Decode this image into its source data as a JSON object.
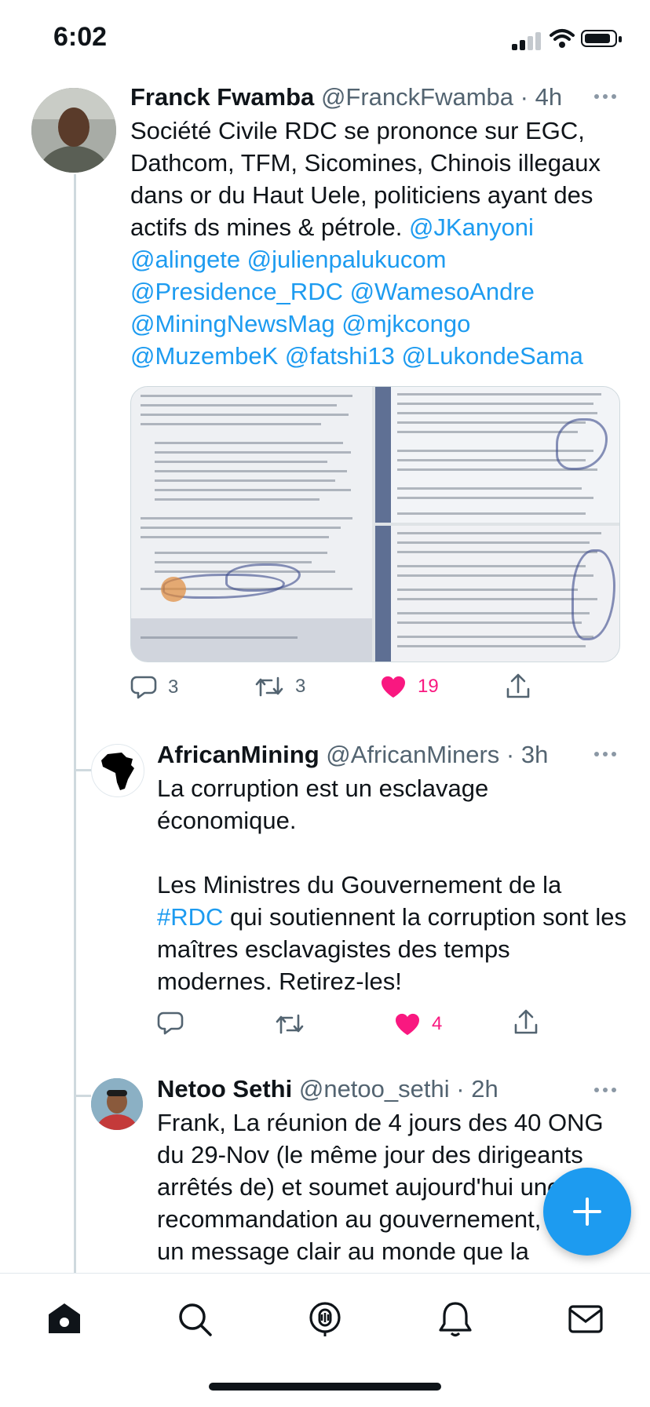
{
  "status_bar": {
    "time": "6:02",
    "battery_level": 0.8
  },
  "tweets": [
    {
      "display_name": "Franck Fwamba",
      "handle": "@FranckFwamba",
      "time": "· 4h",
      "text": "Société Civile RDC se prononce sur EGC, Dathcom, TFM, Sicomines, Chinois illegaux dans or du Haut Uele, politiciens ayant des actifs ds mines & pétrole. ",
      "mentions": "@JKanyoni @alingete @julienpalukucom @Presidence_RDC @WamesoAndre @MiningNewsMag @mjkcongo @MuzembeK @fatshi13 @LukondeSama",
      "replies": "3",
      "retweets": "3",
      "likes": "19"
    },
    {
      "display_name": "AfricanMining",
      "handle": "@AfricanMiners",
      "time": "· 3h",
      "text_part1": "La corruption est un esclavage économique.\n\nLes Ministres du Gouvernement de la ",
      "hashtag": "#RDC",
      "text_part2": " qui soutiennent la corruption sont les maîtres esclavagistes des temps modernes. Retirez-les!",
      "likes": "4"
    },
    {
      "display_name": "Netoo Sethi",
      "handle": "@netoo_sethi",
      "time": "· 2h",
      "text": "Frank, La réunion de 4 jours des 40 ONG du 29-Nov (le même jour des dirigeants arrêtés de) et soumet aujourd'hui une recommandation au gouvernement, envoie un message clair au monde que la"
    }
  ],
  "tab_bar": {
    "items": [
      "home-icon",
      "search-icon",
      "spaces-icon",
      "notifications-icon",
      "messages-icon"
    ]
  },
  "colors": {
    "accent": "#1d9bf0",
    "like": "#f91880",
    "muted": "#536471"
  }
}
